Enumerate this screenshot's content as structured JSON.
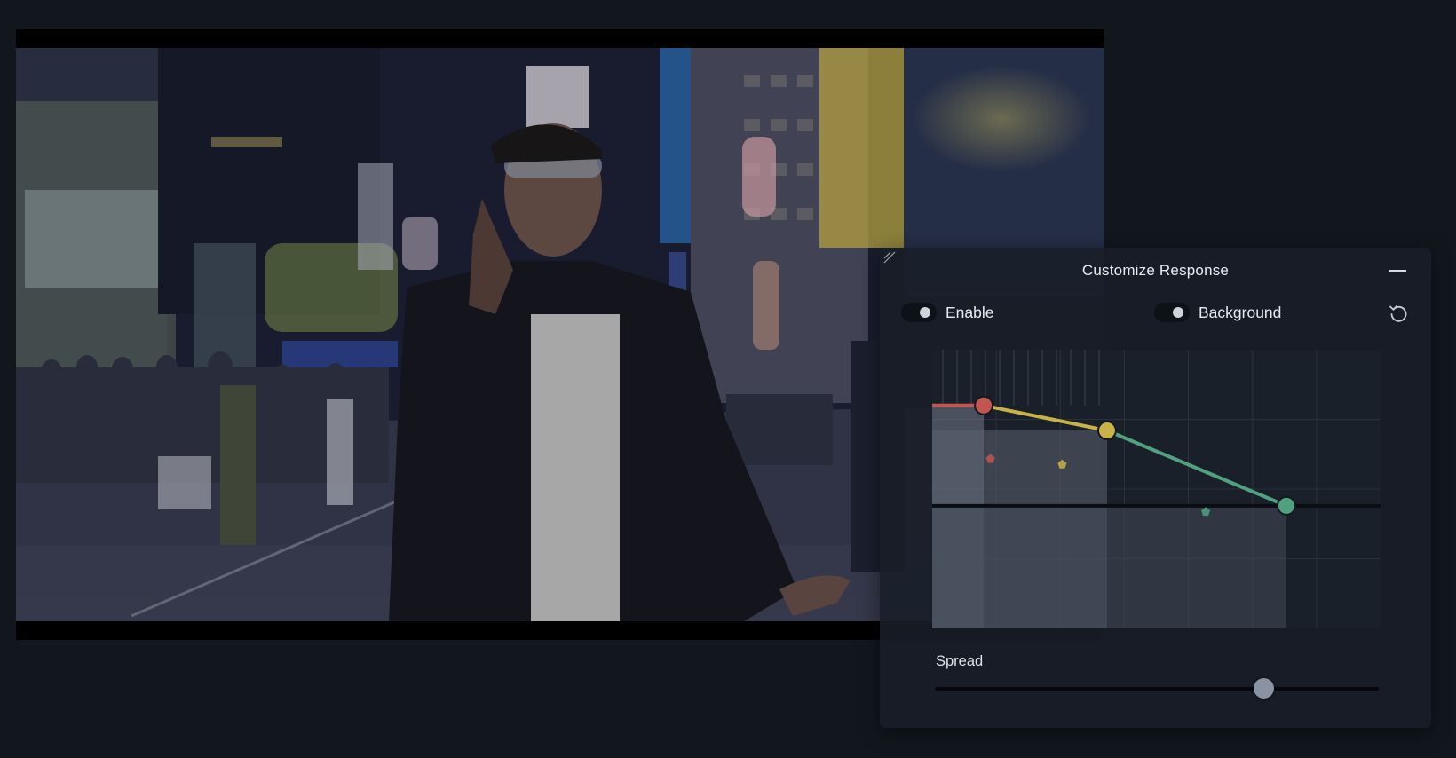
{
  "panel": {
    "title": "Customize Response",
    "enable_label": "Enable",
    "background_label": "Background",
    "spread_label": "Spread"
  },
  "controls": {
    "enable_on": true,
    "background_on": true,
    "spread_value": 0.74
  },
  "colors": {
    "app_background": "#12171e",
    "panel_background": "#181e28",
    "point_red": "#c25550",
    "point_yellow": "#c9b348",
    "point_green": "#4fa27d",
    "slider_thumb": "#8a93a3"
  },
  "curve": {
    "points": [
      {
        "name": "shadows",
        "x": 0.115,
        "y": 0.8,
        "color": "point_red"
      },
      {
        "name": "midtones",
        "x": 0.39,
        "y": 0.71,
        "color": "point_yellow"
      },
      {
        "name": "highlights",
        "x": 0.79,
        "y": 0.44,
        "color": "point_green"
      }
    ],
    "guide_points": [
      {
        "x": 0.13,
        "y": 0.61,
        "color": "point_red"
      },
      {
        "x": 0.29,
        "y": 0.59,
        "color": "point_yellow"
      },
      {
        "x": 0.61,
        "y": 0.42,
        "color": "point_green"
      }
    ]
  },
  "icons": {
    "minimize": "minus-icon",
    "reset": "reset-icon",
    "resize": "resize-grip-icon"
  }
}
